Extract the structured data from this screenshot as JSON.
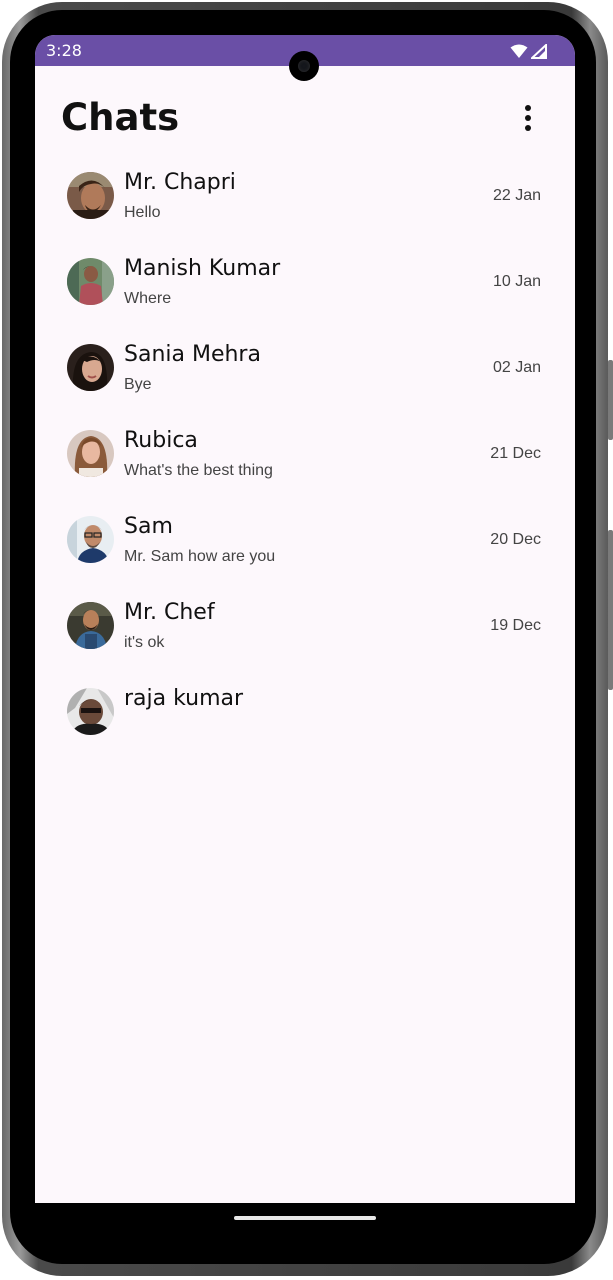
{
  "status_bar": {
    "time": "3:28",
    "background": "#6a4fa6",
    "icons": [
      "wifi-icon",
      "signal-icon"
    ]
  },
  "header": {
    "title": "Chats",
    "menu_icon": "more-vert-icon"
  },
  "chats": [
    {
      "name": "Mr. Chapri",
      "message": "Hello",
      "date": "22 Jan"
    },
    {
      "name": "Manish Kumar",
      "message": "Where",
      "date": "10 Jan"
    },
    {
      "name": "Sania Mehra",
      "message": "Bye",
      "date": "02 Jan"
    },
    {
      "name": "Rubica",
      "message": "What's the best thing",
      "date": "21 Dec"
    },
    {
      "name": "Sam",
      "message": "Mr. Sam how are you",
      "date": "20 Dec"
    },
    {
      "name": "Mr. Chef",
      "message": "it's ok",
      "date": "19 Dec"
    },
    {
      "name": "raja kumar",
      "message": "",
      "date": ""
    }
  ],
  "colors": {
    "accent": "#6a4fa6",
    "screen_background": "#fdf8fc",
    "text_primary": "#111111",
    "text_secondary": "#444444"
  }
}
